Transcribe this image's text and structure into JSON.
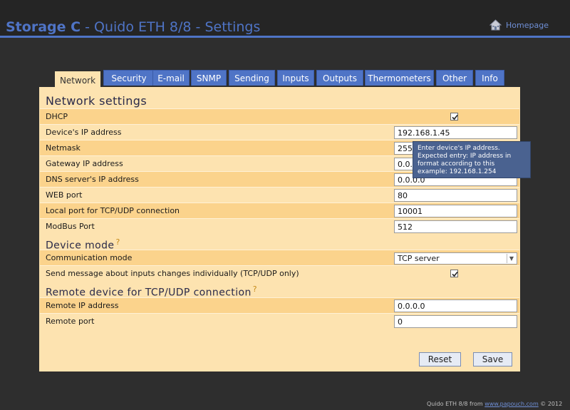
{
  "header": {
    "device_name": "Storage C",
    "title_rest": " - Quido ETH 8/8 - Settings",
    "homepage_label": "Homepage",
    "accent": "#4f74c6"
  },
  "tabs": [
    {
      "label": "Network",
      "active": true
    },
    {
      "label": "Security"
    },
    {
      "label": "E-mail"
    },
    {
      "label": "SNMP"
    },
    {
      "label": "Sending"
    },
    {
      "label": "Inputs"
    },
    {
      "label": "Outputs"
    },
    {
      "label": "Thermometers"
    },
    {
      "label": "Other"
    },
    {
      "label": "Info"
    }
  ],
  "network": {
    "title": "Network settings",
    "dhcp_label": "DHCP",
    "dhcp_checked": true,
    "ip_label": "Device's IP address",
    "ip_value": "192.168.1.45",
    "netmask_label": "Netmask",
    "netmask_value": "255.255.255.0",
    "gateway_label": "Gateway IP address",
    "gateway_value": "0.0.0.0",
    "dns_label": "DNS server's IP address",
    "dns_value": "0.0.0.0",
    "web_port_label": "WEB port",
    "web_port_value": "80",
    "local_port_label": "Local port for TCP/UDP connection",
    "local_port_value": "10001",
    "modbus_label": "ModBus Port",
    "modbus_value": "512"
  },
  "device_mode": {
    "title": "Device mode",
    "help_mark": "?",
    "comm_label": "Communication mode",
    "comm_value": "TCP server",
    "send_label": "Send message about inputs changes individually (TCP/UDP only)",
    "send_checked": true
  },
  "remote": {
    "title": "Remote device for TCP/UDP connection",
    "help_mark": "?",
    "ip_label": "Remote IP address",
    "ip_value": "0.0.0.0",
    "port_label": "Remote port",
    "port_value": "0"
  },
  "buttons": {
    "reset": "Reset",
    "save": "Save"
  },
  "tooltip": {
    "text": "Enter device's IP address. Expected entry: IP address in format according to this example: 192.168.1.254"
  },
  "footer": {
    "prefix": "Quido ETH 8/8 from ",
    "link": "www.papouch.com",
    "suffix": " © 2012"
  }
}
